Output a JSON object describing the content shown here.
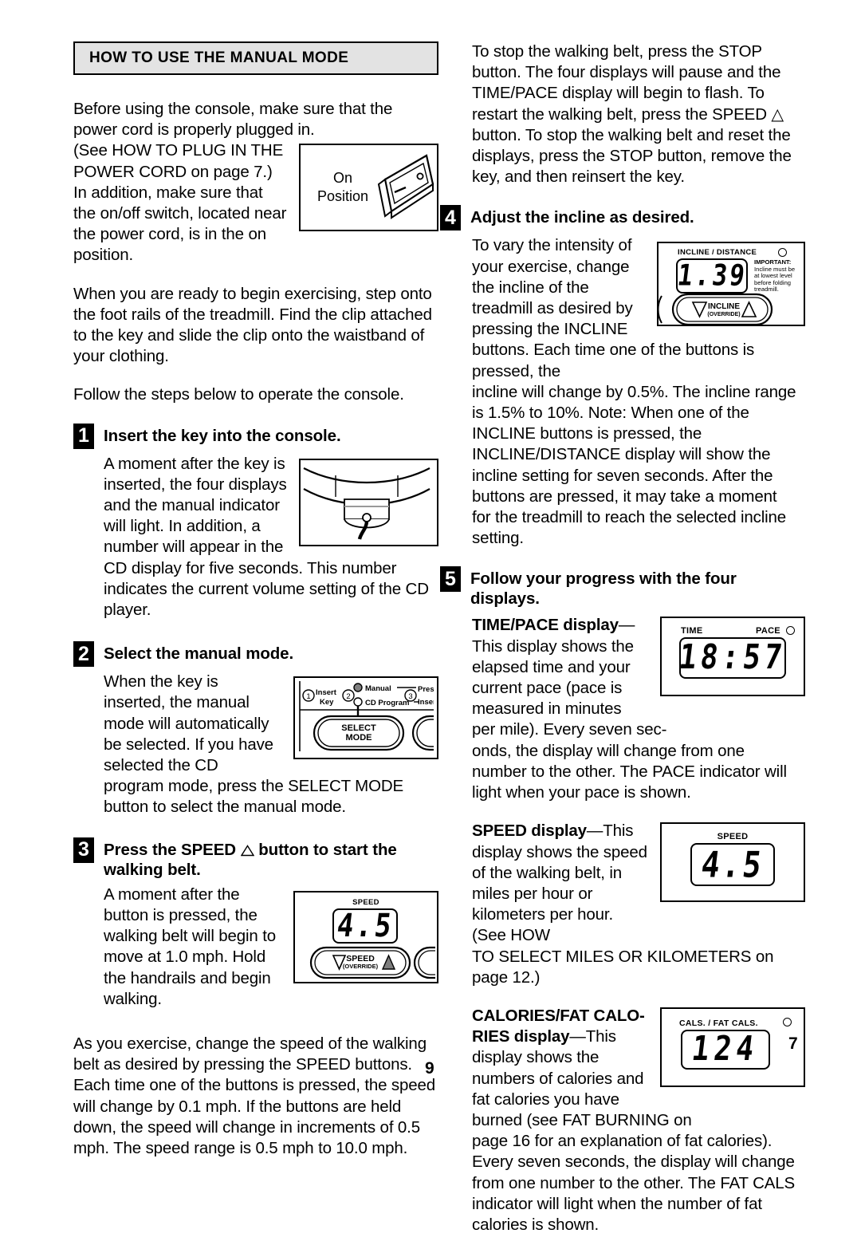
{
  "document": {
    "page_number_center": "9",
    "page_number_right": "7"
  },
  "banner": {
    "title": "HOW TO USE THE MANUAL MODE"
  },
  "left_column": {
    "intro_para_1_a": "Before using the console, make sure that the power cord is properly plugged in.",
    "intro_para_1_b": "(See HOW TO PLUG IN THE POWER CORD on page 7.) In addition, make sure that the on/off switch, located near the power cord, is in the on position.",
    "intro_para_2": "When you are ready to begin exercising, step onto the foot rails of the treadmill. Find the clip attached to the key and slide the clip onto the waistband of your clothing.",
    "intro_para_3": "Follow the steps below to operate the console.",
    "switch_figure": {
      "label_line1": "On",
      "label_line2": "Position"
    },
    "steps": [
      {
        "number": "1",
        "title": "Insert the key into the console.",
        "body": "A moment after the key is inserted, the four displays and the manual indicator will light. In addition, a number will appear in the CD display for five seconds. This number indicates the current volume setting of the CD player."
      },
      {
        "number": "2",
        "title": "Select the manual mode.",
        "body": "When the key is inserted, the manual mode will automatically be selected. If you have selected the CD program mode, press the SELECT MODE button to select the manual mode."
      },
      {
        "number": "3",
        "title_before_tri": "Press the SPEED",
        "title_after_tri": "button to start the walking belt.",
        "body": "A moment after the button is pressed, the walking belt will begin to move at 1.0 mph. Hold the handrails and begin walking."
      }
    ],
    "closing_para": "As you exercise, change the speed of the walking belt as desired by pressing the SPEED buttons. Each time one of the buttons is pressed, the speed will change by 0.1 mph. If the buttons are held down, the speed will change in increments of 0.5 mph. The speed range is 0.5 mph to 10.0 mph.",
    "select_mode_figure": {
      "marker_1": "1",
      "marker_1_line1": "Insert",
      "marker_1_line2": "Key",
      "marker_2": "2",
      "marker_3": "3",
      "marker_3_line1": "Press",
      "marker_3_line2": "Insert",
      "led_manual": "Manual",
      "led_cd_program": "CD Program",
      "button_line1": "SELECT",
      "button_line2": "MODE"
    },
    "speed_figure": {
      "caption": "SPEED",
      "digits": "4.5",
      "button_label": "SPEED",
      "button_sublabel": "(OVERRIDE)"
    }
  },
  "right_column": {
    "stop_para": "To stop the walking belt, press the STOP button. The four displays will pause and the TIME/PACE display will begin to flash. To restart the walking belt, press the SPEED △ button. To stop the walking belt and reset the displays, press the STOP button, remove the key, and then reinsert the key.",
    "steps": [
      {
        "number": "4",
        "title": "Adjust the incline as desired.",
        "body_wrapped": "To vary the intensity of your exercise, change the incline of the treadmill as desired by pressing the INCLINE buttons. Each time one of the buttons is pressed, the",
        "body_full": "incline will change by 0.5%. The incline range is 1.5% to 10%. Note: When one of the INCLINE buttons is pressed, the INCLINE/DISTANCE display will show the incline setting for seven seconds. After the buttons are pressed, it may take a moment for the treadmill to reach the selected incline setting."
      },
      {
        "number": "5",
        "title": "Follow your progress with the four displays."
      }
    ],
    "time_pace": {
      "heading": "TIME/PACE display",
      "dash": "—",
      "body_wrapped": "This display shows the elapsed time and your current pace (pace is measured in minutes per mile). Every seven sec-",
      "body_full": "onds, the display will change from one number to the other. The PACE indicator will light when your pace is shown.",
      "figure": {
        "caption_left": "TIME",
        "caption_right": "PACE",
        "digits": "18:57"
      }
    },
    "speed": {
      "heading": "SPEED display",
      "dash": "—",
      "body_wrapped": "This display shows the speed of the walking belt, in miles per hour or kilometers per hour. (See HOW",
      "body_full": "TO SELECT MILES OR KILOMETERS on page 12.)",
      "figure": {
        "caption": "SPEED",
        "digits": "4.5"
      }
    },
    "calories": {
      "heading_line1": "CALORIES/FAT CALO-",
      "heading_line2": "RIES display",
      "dash": "—",
      "body_wrapped": "This display shows the numbers of calories and fat calories you have burned (see FAT BURNING on",
      "body_full": "page 16 for an explanation of fat calories). Every seven seconds, the display will change from one number to the other. The FAT CALS indicator will light when the number of fat calories is shown.",
      "figure": {
        "caption": "CALS. / FAT CALS.",
        "digits": "124"
      }
    },
    "incline_figure": {
      "caption": "INCLINE / DISTANCE",
      "digits": "1.39",
      "button_label": "INCLINE",
      "button_sublabel": "(OVERRIDE)",
      "important_label": "IMPORTANT:",
      "important_body": "Incline must be at lowest level before folding treadmill."
    }
  }
}
